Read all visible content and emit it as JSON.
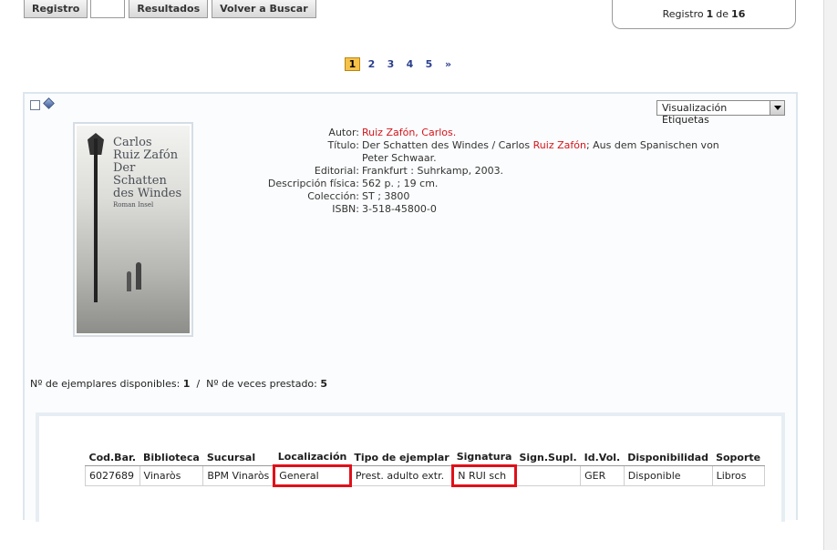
{
  "toolbar": {
    "registro_label": "Registro",
    "registro_value": "",
    "resultados_label": "Resultados",
    "volver_label": "Volver a Buscar"
  },
  "record_counter": {
    "prefix": "Registro",
    "current": "1",
    "middle": "de",
    "total": "16"
  },
  "pagination": {
    "pages": [
      "1",
      "2",
      "3",
      "4",
      "5"
    ],
    "next": "»",
    "current": "1"
  },
  "view_select": {
    "selected": "Visualización Etiquetas"
  },
  "cover": {
    "line1": "Carlos",
    "line2": "Ruiz Zafón",
    "line3": "Der Schatten",
    "line4": "des Windes",
    "publisher": "Roman Insel"
  },
  "bib": {
    "autor_label": "Autor:",
    "autor_value": "Ruiz Zafón, Carlos.",
    "titulo_label": "Título:",
    "titulo_pre": "Der Schatten des Windes / Carlos ",
    "titulo_red": "Ruiz Zafón",
    "titulo_post": "; Aus dem Spanischen von Peter Schwaar.",
    "editorial_label": "Editorial:",
    "editorial_value": "Frankfurt : Suhrkamp, 2003.",
    "descripcion_label": "Descripción física:",
    "descripcion_value": "562 p. ; 19 cm.",
    "coleccion_label": "Colección:",
    "coleccion_value": "ST ; 3800",
    "isbn_label": "ISBN:",
    "isbn_value": "3-518-45800-0"
  },
  "stats": {
    "disponibles_label": "Nº de ejemplares disponibles:",
    "disponibles_value": "1",
    "separator": "/",
    "prestado_label": "Nº de veces prestado:",
    "prestado_value": "5"
  },
  "holdings": {
    "headers": [
      "Cod.Bar.",
      "Biblioteca",
      "Sucursal",
      "Localización",
      "Tipo de ejemplar",
      "Signatura",
      "Sign.Supl.",
      "Id.Vol.",
      "Disponibilidad",
      "Soporte"
    ],
    "rows": [
      [
        "6027689",
        "Vinaròs",
        "BPM Vinaròs",
        "General",
        "Prest. adulto extr.",
        "N RUI sch",
        "",
        "GER",
        "Disponible",
        "Libros"
      ]
    ]
  },
  "colors": {
    "highlight": "#e0101a",
    "link_red": "#d4151b",
    "link_blue": "#2b3f8f",
    "page_current": "#f6c24a"
  }
}
